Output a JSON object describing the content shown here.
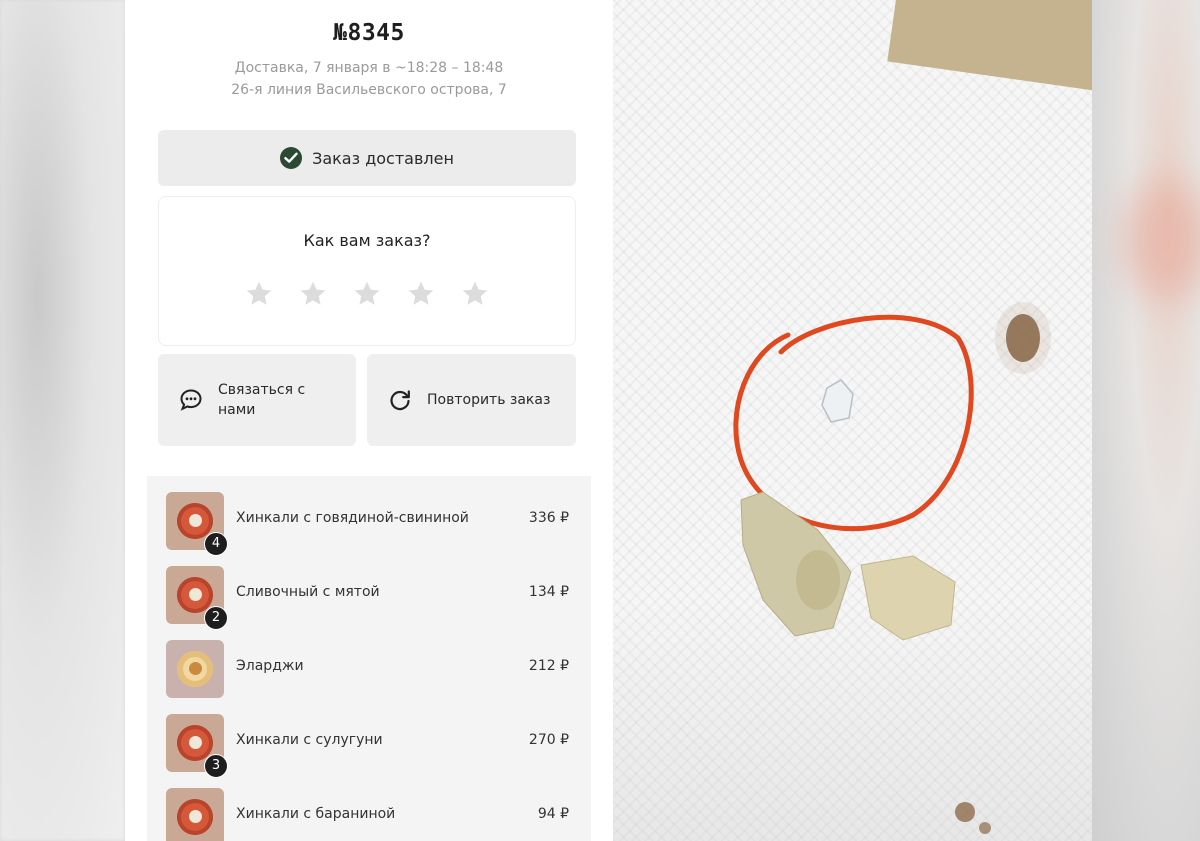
{
  "order": {
    "number": "№8345",
    "delivery": "Доставка, 7 января в ~18:28 – 18:48",
    "address": "26-я линия Васильевского острова, 7"
  },
  "status": {
    "text": "Заказ доставлен",
    "icon": "check-circle-icon"
  },
  "rating": {
    "question": "Как вам заказ?",
    "stars_total": 5,
    "stars_selected": 0
  },
  "actions": {
    "contact": "Связаться с нами",
    "repeat": "Повторить заказ"
  },
  "items": [
    {
      "name": "Хинкали с говядиной-свининой",
      "price": "336 ₽",
      "qty": "4"
    },
    {
      "name": "Сливочный с мятой",
      "price": "134 ₽",
      "qty": "2"
    },
    {
      "name": "Эларджи",
      "price": "212 ₽",
      "qty": ""
    },
    {
      "name": "Хинкали с сулугуни",
      "price": "270 ₽",
      "qty": "3"
    },
    {
      "name": "Хинкали с бараниной",
      "price": "94 ₽",
      "qty": ""
    }
  ],
  "colors": {
    "accent": "#2c4a32",
    "circle_mark": "#e0481f"
  }
}
